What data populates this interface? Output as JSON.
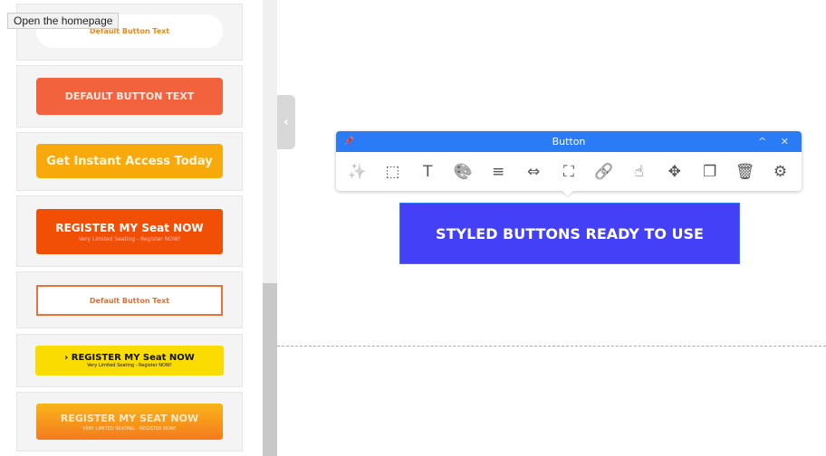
{
  "tooltip": "Open the homepage",
  "templates": [
    {
      "label": "Default Button Text"
    },
    {
      "label": "DEFAULT BUTTON TEXT"
    },
    {
      "label": "Get Instant Access Today"
    },
    {
      "label": "REGISTER MY Seat NOW",
      "sub": "Very Limited Seating - Register NOW!"
    },
    {
      "label": "Default Button Text"
    },
    {
      "label": "› REGISTER MY Seat NOW",
      "sub": "Very Limited Seating - Register NOW!"
    },
    {
      "label": "REGISTER MY SEAT NOW",
      "sub": "VERY LIMITED SEATING - REGISTER NOW!"
    }
  ],
  "toolbar": {
    "title": "Button",
    "pin": "📌",
    "controls": "^ ✕",
    "icons": [
      {
        "name": "magic-wand-icon",
        "glyph": "✨"
      },
      {
        "name": "select-cursor-icon",
        "glyph": "⬚"
      },
      {
        "name": "text-icon",
        "glyph": "T"
      },
      {
        "name": "palette-icon",
        "glyph": "🎨"
      },
      {
        "name": "align-center-icon",
        "glyph": "≡"
      },
      {
        "name": "spacing-icon",
        "glyph": "⇔"
      },
      {
        "name": "fullscreen-icon",
        "glyph": "⛶"
      },
      {
        "name": "link-icon",
        "glyph": "🔗"
      },
      {
        "name": "click-hand-icon",
        "glyph": "☝"
      },
      {
        "name": "move-icon",
        "glyph": "✥"
      },
      {
        "name": "duplicate-icon",
        "glyph": "❐"
      },
      {
        "name": "trash-icon",
        "glyph": "🗑"
      },
      {
        "name": "gear-icon",
        "glyph": "⚙"
      }
    ]
  },
  "canvas_button": "STYLED BUTTONS READY TO USE",
  "collapse_glyph": "‹"
}
